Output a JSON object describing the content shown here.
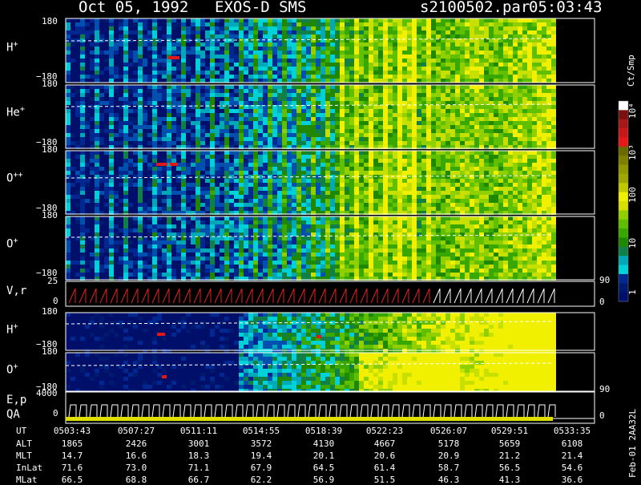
{
  "header": {
    "date": "Oct 05, 1992",
    "mission": "EXOS-D SMS",
    "file": "s2100502.par",
    "time": "05:03:43"
  },
  "panels": [
    {
      "label": "H",
      "sup": "+",
      "ytop": "180",
      "ybot": "−180"
    },
    {
      "label": "He",
      "sup": "+",
      "ytop": "180",
      "ybot": "−180"
    },
    {
      "label": "O",
      "sup": "++",
      "ytop": "180",
      "ybot": "−180"
    },
    {
      "label": "O",
      "sup": "+",
      "ytop": "180",
      "ybot": "−180"
    },
    {
      "label": "V,r",
      "sup": "",
      "ytop": "25",
      "ybot": "0",
      "right_top": "90",
      "right_bot": "0"
    },
    {
      "label": "H",
      "sup": "+",
      "ytop": "180",
      "ybot": "−180"
    },
    {
      "label": "O",
      "sup": "+",
      "ytop": "180",
      "ybot": "−180"
    },
    {
      "label": "E,p",
      "sup": "",
      "ytop": "4000",
      "ybot": "0",
      "right_top": "90",
      "right_bot": "0"
    }
  ],
  "qa_label": "QA",
  "colorbar": {
    "unit": "Ct/Smp",
    "ticks": [
      "10⁴",
      "10³",
      "100",
      "10",
      "1"
    ],
    "colors": [
      "#ffffff",
      "#7a1010",
      "#a81818",
      "#c81818",
      "#e81818",
      "#6a6a00",
      "#808000",
      "#909a00",
      "#a0a800",
      "#c0c800",
      "#f0f000",
      "#d8e000",
      "#90d000",
      "#60c000",
      "#38a800",
      "#208800",
      "#108048",
      "#00a8b8",
      "#00d0d8",
      "#002890",
      "#001a70",
      "#00106a"
    ]
  },
  "side_note": "Feb-01 2AA32L",
  "table": {
    "rows": [
      {
        "name": "UT",
        "values": [
          "0503:43",
          "0507:27",
          "0511:11",
          "0514:55",
          "0518:39",
          "0522:23",
          "0526:07",
          "0529:51",
          "0533:35"
        ]
      },
      {
        "name": "ALT",
        "values": [
          "1865",
          "2426",
          "3001",
          "3572",
          "4130",
          "4667",
          "5178",
          "5659",
          "6108"
        ]
      },
      {
        "name": "MLT",
        "values": [
          "14.7",
          "16.6",
          "18.3",
          "19.4",
          "20.1",
          "20.6",
          "20.9",
          "21.2",
          "21.4"
        ]
      },
      {
        "name": "InLat",
        "values": [
          "71.6",
          "73.0",
          "71.1",
          "67.9",
          "64.5",
          "61.4",
          "58.7",
          "56.5",
          "54.6"
        ]
      },
      {
        "name": "MLat",
        "values": [
          "66.5",
          "68.8",
          "66.7",
          "62.2",
          "56.9",
          "51.5",
          "46.3",
          "41.3",
          "36.6"
        ]
      }
    ]
  },
  "chart_data": {
    "type": "heatmap",
    "title": "Oct 05, 1992   EXOS-D SMS",
    "x_ticks": [
      "0503:43",
      "0507:27",
      "0511:11",
      "0514:55",
      "0518:39",
      "0522:23",
      "0526:07",
      "0529:51",
      "0533:35"
    ],
    "colorbar_scale": "log",
    "colorbar_range": [
      1,
      10000
    ],
    "colorbar_label": "Ct/Smp",
    "panels": [
      {
        "species": "H+",
        "y_range": [
          -180,
          180
        ]
      },
      {
        "species": "He+",
        "y_range": [
          -180,
          180
        ]
      },
      {
        "species": "O++",
        "y_range": [
          -180,
          180
        ]
      },
      {
        "species": "O+",
        "y_range": [
          -180,
          180
        ]
      },
      {
        "species": "V,r",
        "y_range": [
          0,
          25
        ]
      },
      {
        "species": "H+",
        "y_range": [
          -180,
          180
        ]
      },
      {
        "species": "O+",
        "y_range": [
          -180,
          180
        ]
      },
      {
        "species": "E,p",
        "y_range": [
          0,
          4000
        ]
      }
    ]
  }
}
